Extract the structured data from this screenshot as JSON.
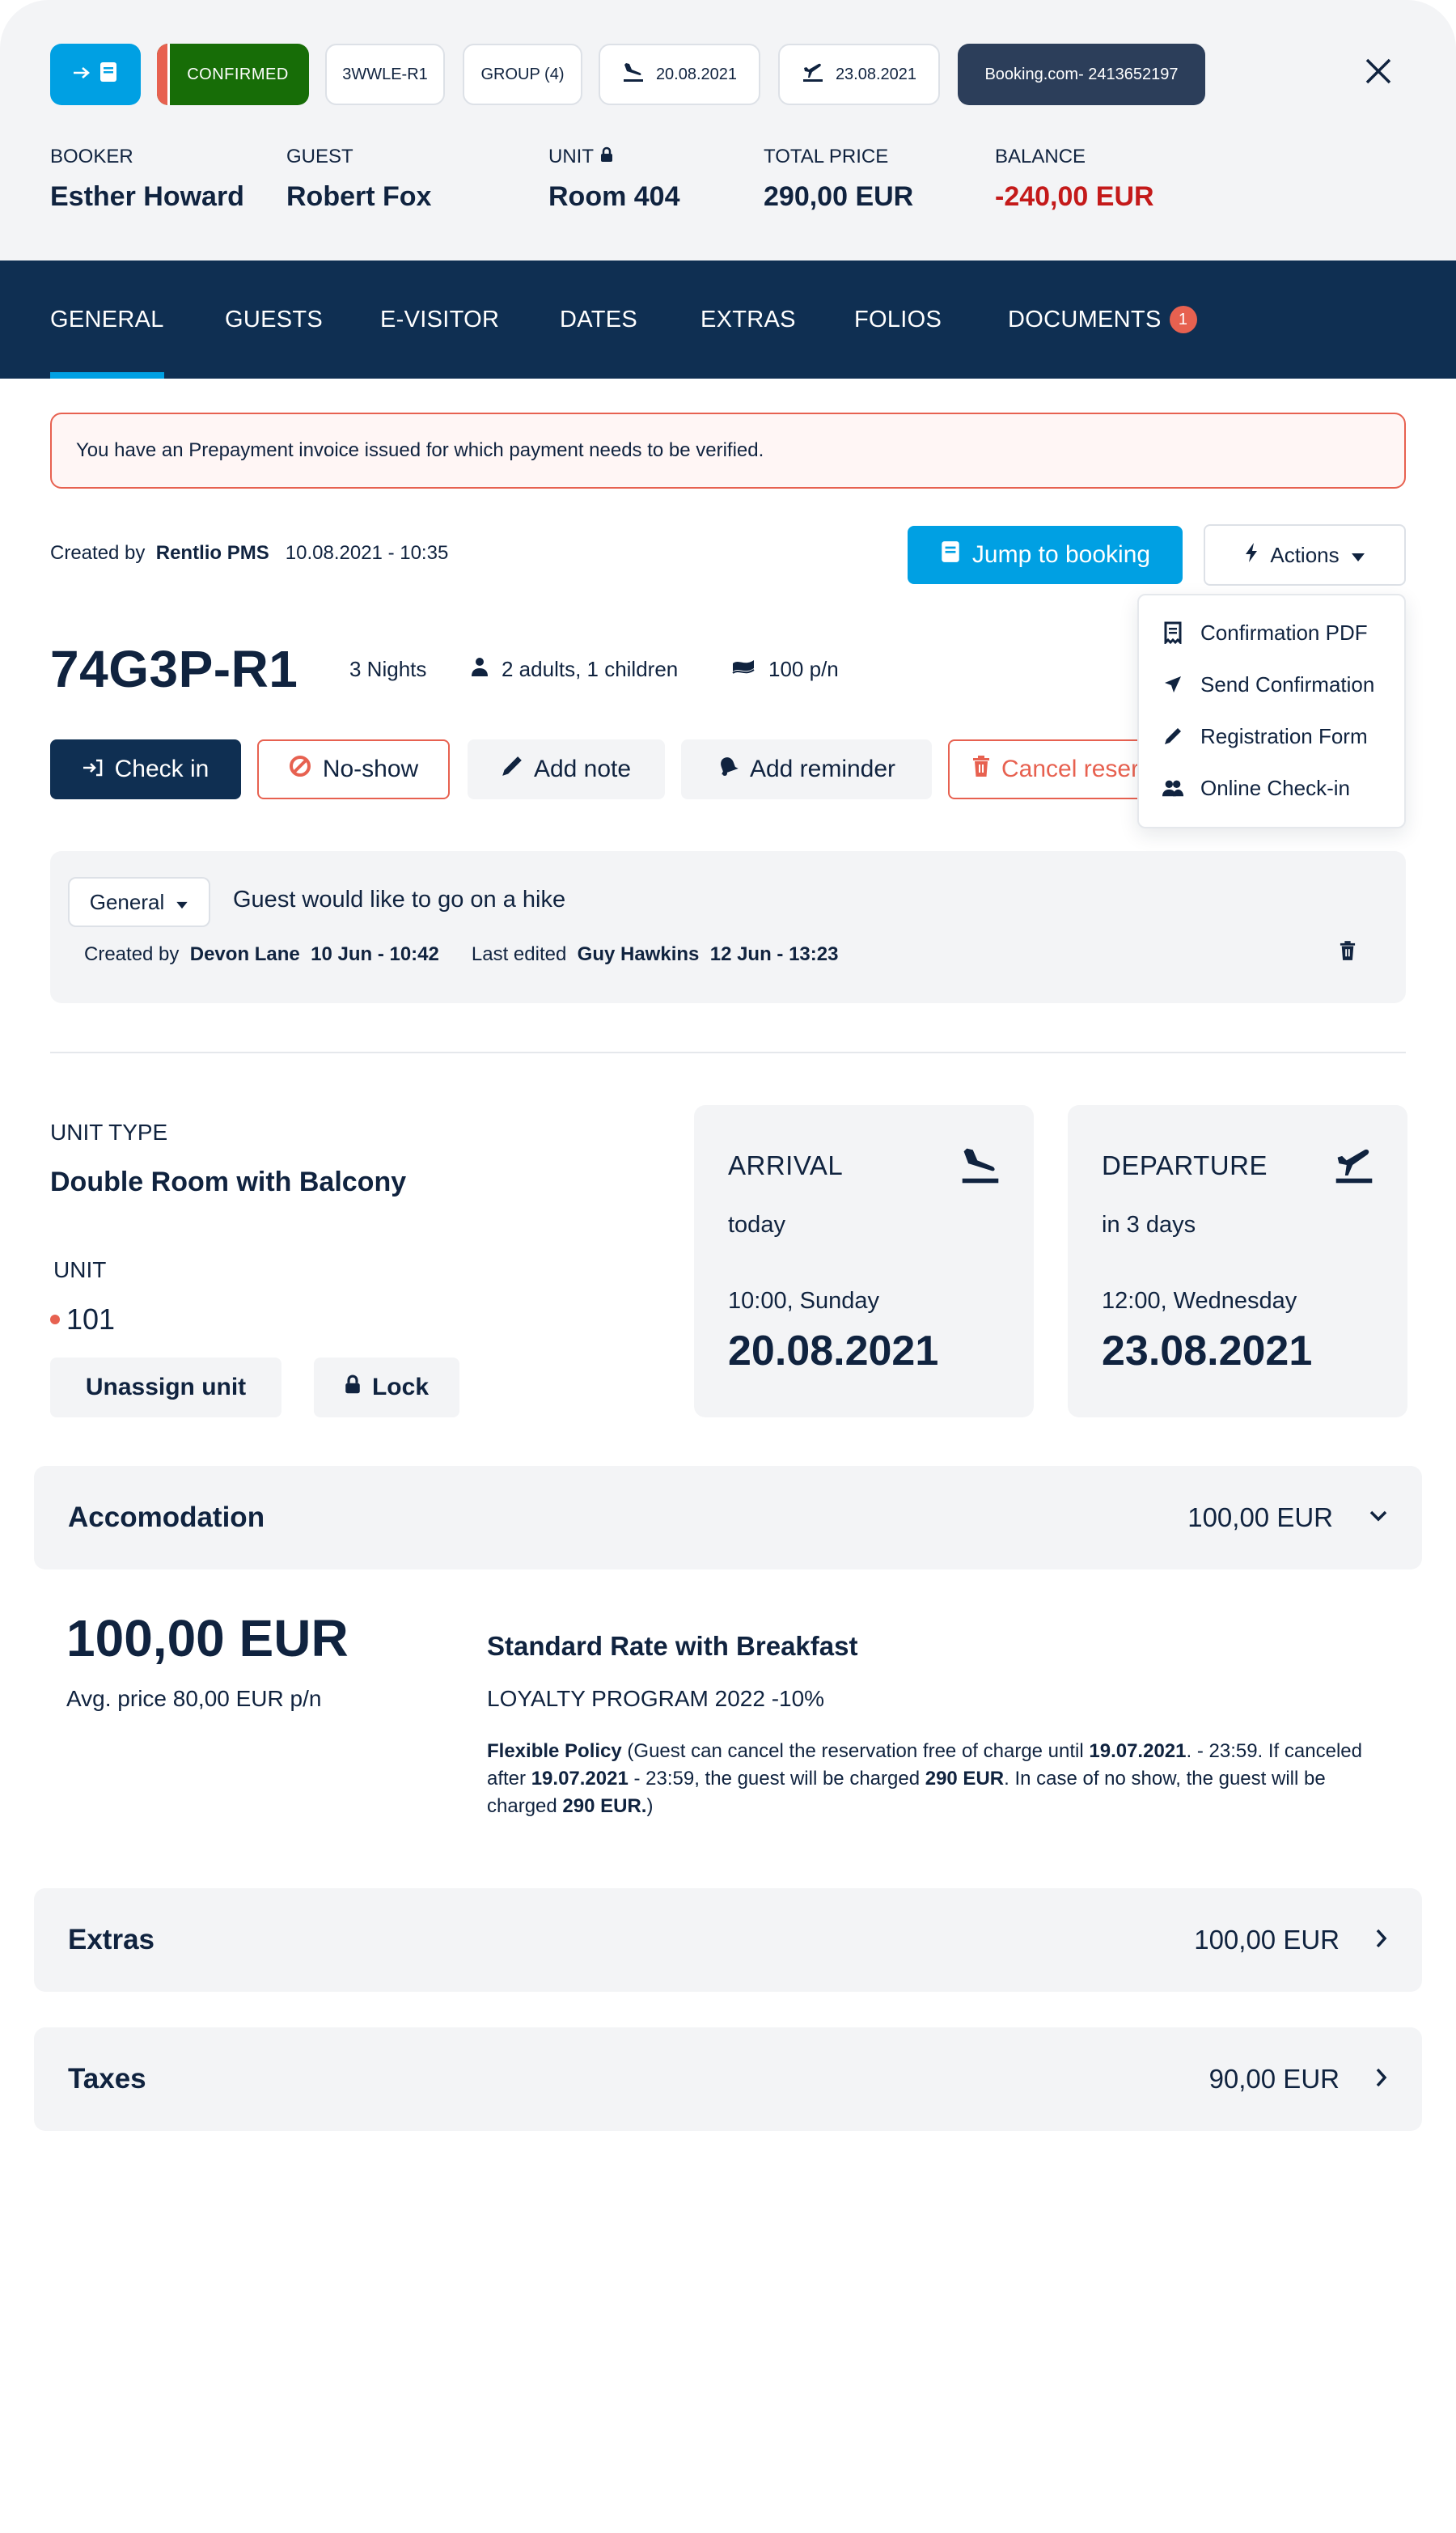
{
  "header": {
    "chips": {
      "status": "CONFIRMED",
      "reservation_code": "3WWLE-R1",
      "group": "GROUP (4)",
      "arrival_date": "20.08.2021",
      "departure_date": "23.08.2021",
      "source": "Booking.com- 2413652197"
    },
    "meta": [
      {
        "label": "BOOKER",
        "value": "Esther Howard"
      },
      {
        "label": "GUEST",
        "value": "Robert Fox"
      },
      {
        "label": "UNIT",
        "value": "Room 404"
      },
      {
        "label": "TOTAL PRICE",
        "value": "290,00 EUR"
      },
      {
        "label": "BALANCE",
        "value": "-240,00 EUR"
      }
    ]
  },
  "tabs": [
    {
      "label": "GENERAL",
      "active": true
    },
    {
      "label": "GUESTS"
    },
    {
      "label": "E-VISITOR"
    },
    {
      "label": "DATES"
    },
    {
      "label": "EXTRAS"
    },
    {
      "label": "FOLIOS"
    },
    {
      "label": "DOCUMENTS",
      "badge": "1"
    }
  ],
  "alert": "You have an Prepayment invoice issued for which payment needs to be verified.",
  "created": {
    "prefix": "Created by",
    "by": "Rentlio PMS",
    "at": "10.08.2021 - 10:35"
  },
  "toolbar": {
    "jump_label": "Jump to booking",
    "actions_label": "Actions",
    "actions_menu": [
      {
        "label": "Confirmation PDF",
        "icon": "receipt-icon"
      },
      {
        "label": "Send Confirmation",
        "icon": "send-icon"
      },
      {
        "label": "Registration Form",
        "icon": "pencil-icon"
      },
      {
        "label": "Online Check-in",
        "icon": "users-icon"
      }
    ]
  },
  "reservation": {
    "code": "74G3P-R1",
    "nights": "3 Nights",
    "occupancy": "2 adults, 1 children",
    "rate": "100 p/n"
  },
  "buttons": {
    "check_in": "Check in",
    "no_show": "No-show",
    "add_note": "Add note",
    "add_reminder": "Add reminder",
    "cancel": "Cancel reservation"
  },
  "note": {
    "type": "General",
    "text": "Guest would like to go on a hike",
    "created_prefix": "Created by",
    "created_by": "Devon Lane",
    "created_at": "10 Jun - 10:42",
    "edited_prefix": "Last edited",
    "edited_by": "Guy Hawkins",
    "edited_at": "12 Jun - 13:23"
  },
  "unit": {
    "type_label": "UNIT TYPE",
    "type_value": "Double Room with Balcony",
    "unit_label": "UNIT",
    "unit_value": "101",
    "unassign_label": "Unassign unit",
    "lock_label": "Lock"
  },
  "arrival": {
    "title": "ARRIVAL",
    "relative": "today",
    "time": "10:00, Sunday",
    "date": "20.08.2021"
  },
  "departure": {
    "title": "DEPARTURE",
    "relative": "in 3 days",
    "time": "12:00, Wednesday",
    "date": "23.08.2021"
  },
  "accommodation": {
    "title": "Accomodation",
    "amount": "100,00 EUR",
    "price": "100,00 EUR",
    "avg": "Avg. price 80,00 EUR p/n",
    "rate_name": "Standard Rate with Breakfast",
    "promo": "LOYALTY PROGRAM 2022 -10%",
    "policy": {
      "name": "Flexible Policy",
      "t1": " (Guest can cancel the reservation free of charge until ",
      "d1": "19.07.2021",
      "t2": ". - 23:59. If canceled after ",
      "d2": "19.07.2021",
      "t3": " - 23:59, the guest will be charged ",
      "a1": "290 EUR",
      "t4": ". In case of no show, the guest will be charged ",
      "a2": "290 EUR.",
      "t5": ")"
    }
  },
  "extras": {
    "title": "Extras",
    "amount": "100,00 EUR"
  },
  "taxes": {
    "title": "Taxes",
    "amount": "90,00 EUR"
  },
  "colors": {
    "navy": "#0f2f52",
    "accent": "#00a0e3",
    "confirmed": "#176d07",
    "danger": "#e76150",
    "negative": "#c41a1a"
  }
}
